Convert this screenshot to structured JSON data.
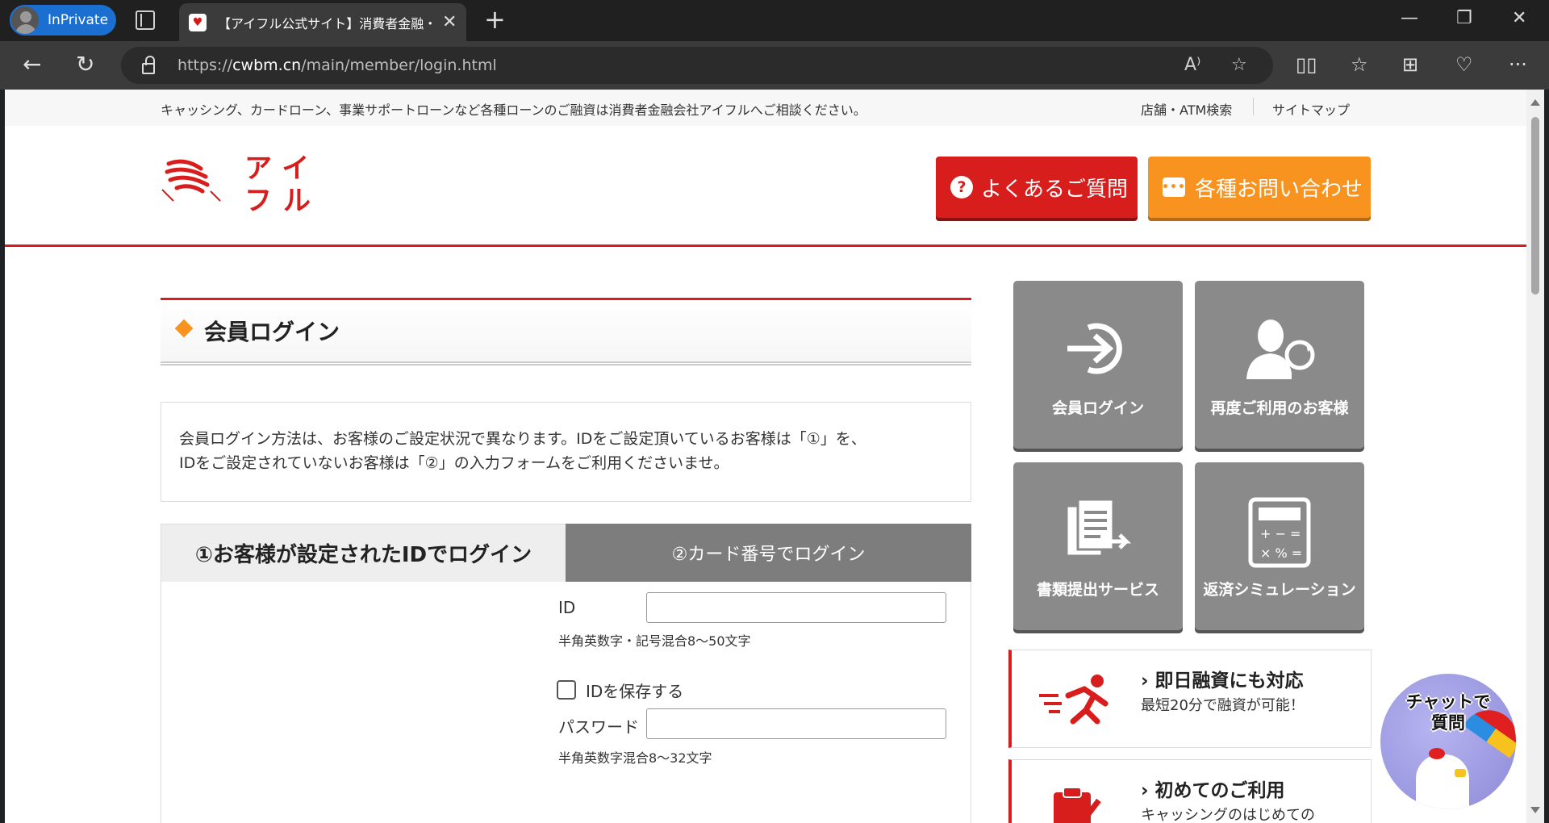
{
  "browser": {
    "inprivate_label": "InPrivate",
    "tab_title": "【アイフル公式サイト】消費者金融・キャッシング",
    "url_prefix": "https://",
    "url_domain": "cwbm.cn",
    "url_path": "/main/member/login.html"
  },
  "topstrip": {
    "notice": "キャッシング、カードローン、事業サポートローンなど各種ローンのご融資は消費者金融会社アイフルへご相談ください。",
    "store_search": "店舗・ATM検索",
    "sitemap": "サイトマップ"
  },
  "header": {
    "logo_text": "アイフル",
    "faq_label": "よくあるご質問",
    "faq_icon": "?",
    "contact_label": "各種お問い合わせ",
    "contact_icon": "•••"
  },
  "main": {
    "title": "会員ログイン",
    "info_line1": "会員ログイン方法は、お客様のご設定状況で異なります。IDをご設定頂いているお客様は「①」を、",
    "info_line2": "IDをご設定されていないお客様は「②」の入力フォームをご利用くださいませ。",
    "tab_id_login": "①お客様が設定されたIDでログイン",
    "tab_card_login": "②カード番号でログイン",
    "form": {
      "id_label": "ID",
      "id_value": "",
      "id_hint": "半角英数字・記号混合8～50文字",
      "save_id_label": "IDを保存する",
      "password_label": "パスワード",
      "password_value": "",
      "password_hint": "半角英数字混合8～32文字"
    }
  },
  "sidebar": {
    "tiles": [
      {
        "label": "会員ログイン",
        "icon": "login-arrow-icon"
      },
      {
        "label": "再度ご利用のお客様",
        "icon": "returning-user-icon"
      },
      {
        "label": "書類提出サービス",
        "icon": "document-submit-icon"
      },
      {
        "label": "返済シミュレーション",
        "icon": "calculator-icon"
      }
    ],
    "features": [
      {
        "head": "即日融資にも対応",
        "sub": "最短20分で融資が可能！",
        "icon": "running-person-icon"
      },
      {
        "head": "初めてのご利用",
        "sub": "キャッシングのはじめての",
        "icon": "clipboard-icon"
      }
    ]
  },
  "chat": {
    "label_line1": "チャットで",
    "label_line2": "質問"
  },
  "colors": {
    "brand_red": "#d81d1d",
    "accent_orange": "#f7931e",
    "tile_gray": "#8a8a8a"
  }
}
